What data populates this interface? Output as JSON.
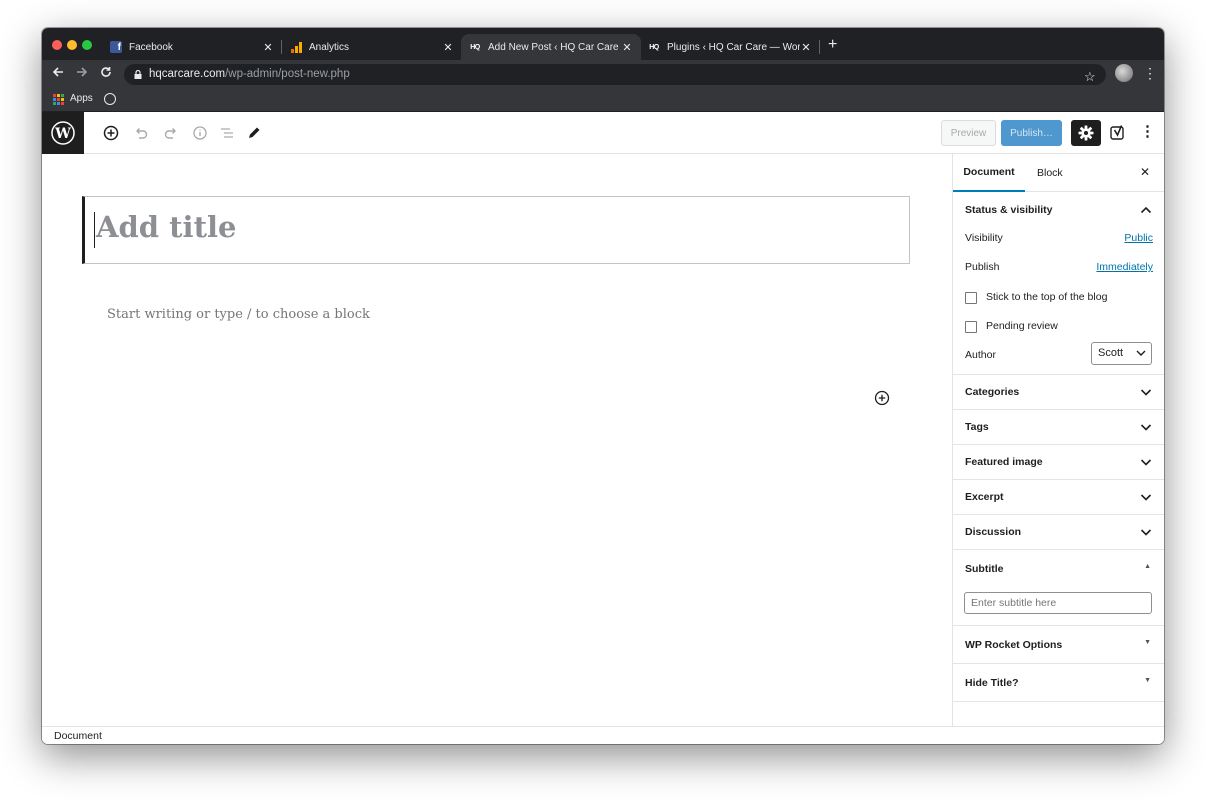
{
  "browser": {
    "tabs": [
      {
        "title": "Facebook",
        "icon": "facebook-icon"
      },
      {
        "title": "Analytics",
        "icon": "analytics-icon"
      },
      {
        "title": "Add New Post ‹ HQ Car Care —",
        "icon": "hq-icon"
      },
      {
        "title": "Plugins ‹ HQ Car Care — Word",
        "icon": "hq-icon"
      }
    ],
    "hq_favicon_text": "HQ",
    "url_domain": "hqcarcare.com",
    "url_path": "/wp-admin/post-new.php",
    "bookmarks": {
      "apps_label": "Apps"
    }
  },
  "editor": {
    "header": {
      "preview_label": "Preview",
      "publish_label": "Publish…"
    },
    "title_placeholder": "Add title",
    "body_placeholder": "Start writing or type / to choose a block"
  },
  "sidebar": {
    "tabs": {
      "document": "Document",
      "block": "Block"
    },
    "status": {
      "heading": "Status & visibility",
      "visibility_label": "Visibility",
      "visibility_value": "Public",
      "publish_label": "Publish",
      "publish_value": "Immediately",
      "sticky_label": "Stick to the top of the blog",
      "pending_label": "Pending review",
      "author_label": "Author",
      "author_value": "Scott"
    },
    "panels": [
      "Categories",
      "Tags",
      "Featured image",
      "Excerpt",
      "Discussion"
    ],
    "subtitle": {
      "heading": "Subtitle",
      "placeholder": "Enter subtitle here"
    },
    "extra_panels": [
      "WP Rocket Options",
      "Hide Title?"
    ]
  },
  "statusbar": {
    "label": "Document"
  },
  "colors": {
    "accent": "#007cba",
    "publish": "#4e98cf",
    "link": "#0073aa",
    "chrome_dark": "#202124"
  }
}
